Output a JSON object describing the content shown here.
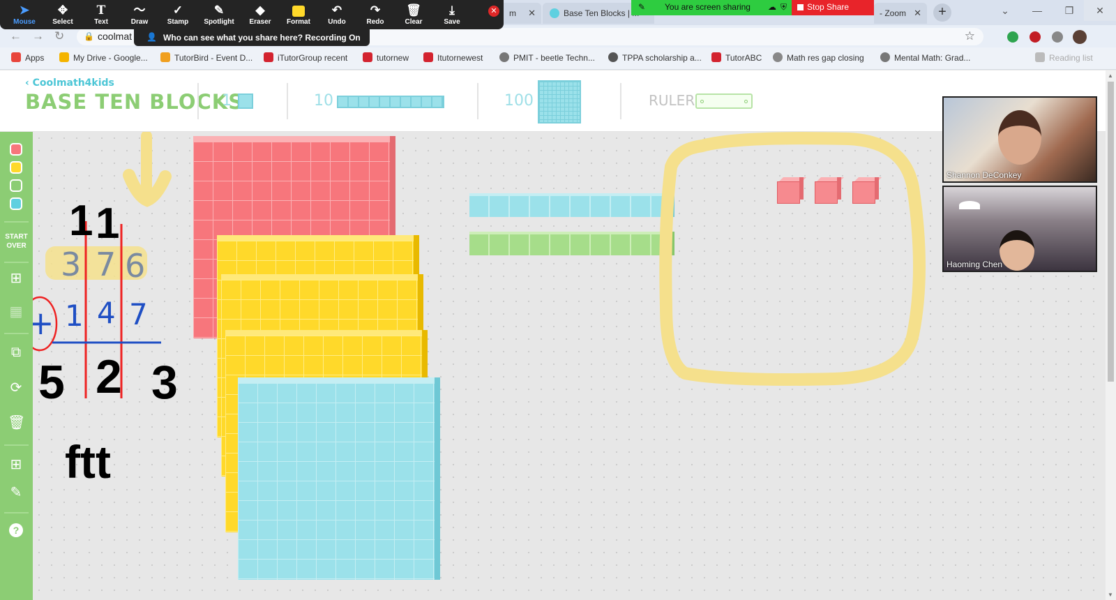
{
  "zoom_toolbar": {
    "tools": [
      {
        "label": "Mouse",
        "icon": "cursor-icon",
        "active": true
      },
      {
        "label": "Select",
        "icon": "move-icon"
      },
      {
        "label": "Text",
        "icon": "text-icon"
      },
      {
        "label": "Draw",
        "icon": "draw-icon"
      },
      {
        "label": "Stamp",
        "icon": "stamp-icon"
      },
      {
        "label": "Spotlight",
        "icon": "spotlight-icon"
      },
      {
        "label": "Eraser",
        "icon": "eraser-icon"
      },
      {
        "label": "Format",
        "icon": "format-icon"
      },
      {
        "label": "Undo",
        "icon": "undo-icon"
      },
      {
        "label": "Redo",
        "icon": "redo-icon"
      },
      {
        "label": "Clear",
        "icon": "trash-icon"
      },
      {
        "label": "Save",
        "icon": "save-icon"
      }
    ],
    "who_can_see": "Who can see what you share here? Recording On",
    "sharing_status": "You are screen sharing",
    "stop_share": "Stop Share"
  },
  "browser": {
    "tabs": [
      {
        "title": "m"
      },
      {
        "title": "Base Ten Blocks | M"
      },
      {
        "title": "- Zoom"
      }
    ],
    "url": "coolmat",
    "bookmarks": [
      {
        "label": "Apps",
        "color": "#e8453c"
      },
      {
        "label": "My Drive - Google...",
        "color": "#f4b400"
      },
      {
        "label": "TutorBird - Event D...",
        "color": "#f0a020"
      },
      {
        "label": "iTutorGroup recent",
        "color": "#d3232f"
      },
      {
        "label": "tutornew",
        "color": "#d3232f"
      },
      {
        "label": "Itutornewest",
        "color": "#d3232f"
      },
      {
        "label": "PMIT - beetle Techn...",
        "color": "#777777"
      },
      {
        "label": "TPPA scholarship a...",
        "color": "#555555"
      },
      {
        "label": "TutorABC",
        "color": "#d3232f"
      },
      {
        "label": "Math res gap closing",
        "color": "#888888"
      },
      {
        "label": "Mental Math: Grad...",
        "color": "#777777"
      },
      {
        "label": "Reading list",
        "color": "#aaaaaa"
      }
    ]
  },
  "app": {
    "back_link": "Coolmath4kids",
    "title": "BASE TEN BLOCKS",
    "block_labels": {
      "ones": "1",
      "tens": "10",
      "hundreds": "100",
      "ruler": "RULER"
    },
    "start_over": "START OVER",
    "swatches": [
      "#f7767c",
      "#ffd92a",
      "#8ccd74",
      "#5fd0e0"
    ],
    "sidebar_icons": [
      "layout-grid-icon",
      "grid-icon",
      "copy-blocks-icon",
      "regroup-icon",
      "trash-icon",
      "calculator-icon",
      "pencil-icon",
      "help-icon"
    ]
  },
  "annotations": {
    "carry": [
      "1",
      "1"
    ],
    "addend1": [
      "3",
      "7",
      "6"
    ],
    "operator": "+",
    "addend2": [
      "1",
      "4",
      "7"
    ],
    "sum": [
      "5",
      "2",
      "3"
    ],
    "note": "ftt"
  },
  "participants": [
    {
      "name": "Shannon DeConkey"
    },
    {
      "name": "Haoming Chen"
    }
  ],
  "colors": {
    "brand_green": "#8ccd74",
    "brand_blue": "#4cc6d6",
    "block_red": "#f7767c",
    "block_yellow": "#ffd92a",
    "block_blue": "#9be1ea",
    "block_green": "#a6dd8a",
    "highlight": "#f5e08c"
  }
}
